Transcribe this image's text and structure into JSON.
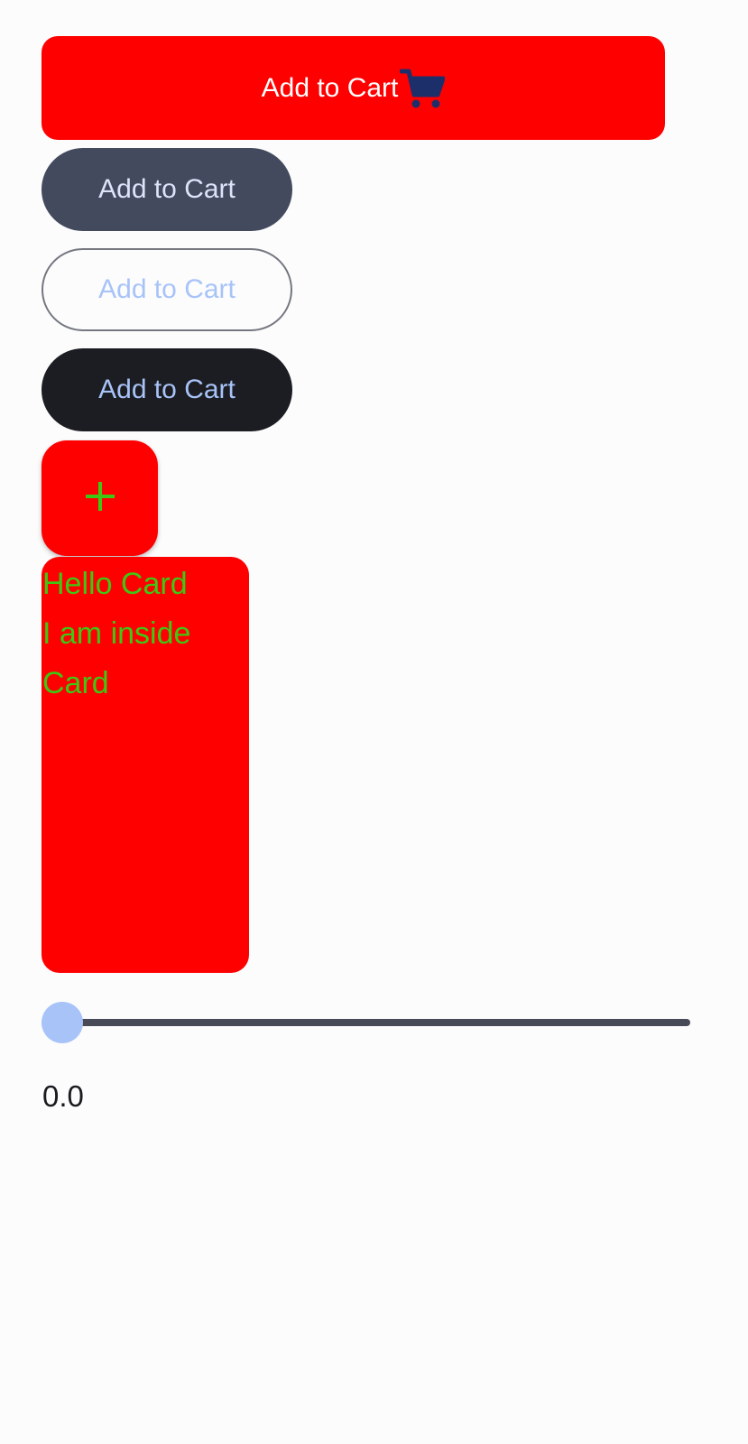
{
  "buttons": {
    "primary_cart_label": "Add to Cart",
    "tonal_label": "Add to Cart",
    "outlined_label": "Add to Cart",
    "dark_label": "Add to Cart"
  },
  "icons": {
    "cart": "shopping-cart-icon",
    "fab": "plus-icon"
  },
  "card": {
    "lines": [
      "Hello Card",
      "I am inside",
      "Card"
    ]
  },
  "slider": {
    "value": 0.0,
    "value_text": "0.0"
  },
  "colors": {
    "accent_red": "#ff0000",
    "card_text_green": "#3cc813",
    "cart_icon_navy": "#1c2f6b",
    "slider_thumb": "#a8c3f8",
    "slider_track": "#484b57"
  }
}
